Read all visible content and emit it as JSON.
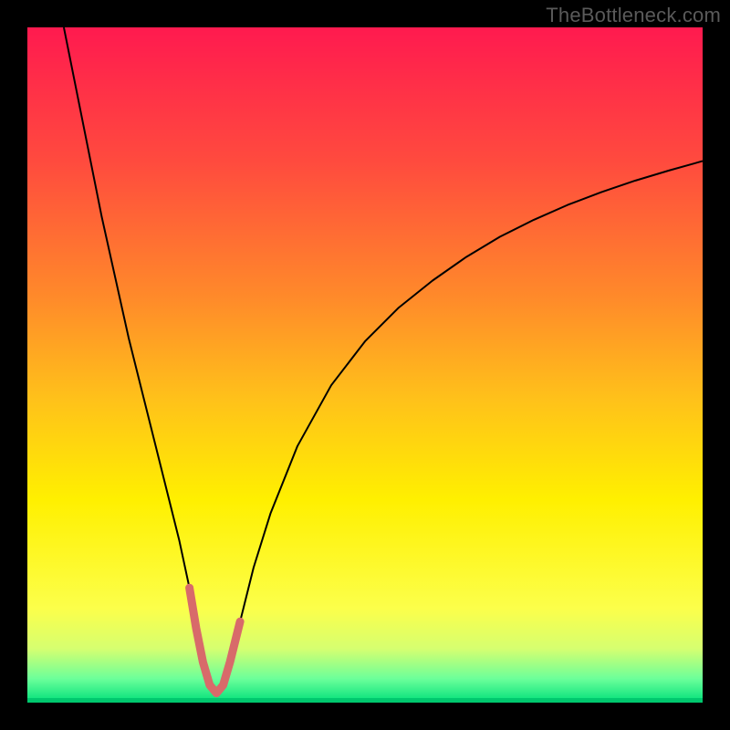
{
  "watermark": "TheBottleneck.com",
  "chart_data": {
    "type": "line",
    "title": "",
    "xlabel": "",
    "ylabel": "",
    "xlim": [
      0,
      100
    ],
    "ylim": [
      0,
      100
    ],
    "gradient": {
      "stops": [
        {
          "offset": 0.0,
          "color": "#ff1a4f"
        },
        {
          "offset": 0.2,
          "color": "#ff4b3e"
        },
        {
          "offset": 0.4,
          "color": "#ff8a2a"
        },
        {
          "offset": 0.55,
          "color": "#ffc11a"
        },
        {
          "offset": 0.7,
          "color": "#fff000"
        },
        {
          "offset": 0.86,
          "color": "#fcff4a"
        },
        {
          "offset": 0.92,
          "color": "#d6ff70"
        },
        {
          "offset": 0.965,
          "color": "#6bff9a"
        },
        {
          "offset": 1.0,
          "color": "#00e07a"
        }
      ]
    },
    "series": [
      {
        "name": "curve",
        "stroke": "#000000",
        "stroke_width": 2,
        "x": [
          5.4,
          7,
          9,
          11,
          13,
          15,
          17,
          19,
          21,
          22.5,
          24,
          25,
          26,
          27,
          28,
          29,
          30,
          31.5,
          33.5,
          36,
          40,
          45,
          50,
          55,
          60,
          65,
          70,
          75,
          80,
          85,
          90,
          95,
          100
        ],
        "y": [
          100,
          92,
          82,
          72,
          63,
          54,
          46,
          38,
          30,
          24,
          17,
          11,
          6,
          2.6,
          1.4,
          2.6,
          6,
          12,
          20,
          28,
          38,
          47,
          53.5,
          58.5,
          62.5,
          66,
          69,
          71.5,
          73.7,
          75.6,
          77.3,
          78.8,
          80.2
        ]
      },
      {
        "name": "highlight",
        "stroke": "#d86a6a",
        "stroke_width": 9,
        "linecap": "round",
        "x": [
          24,
          25,
          26,
          27,
          28,
          29,
          30,
          31.5
        ],
        "y": [
          17,
          11,
          6,
          2.6,
          1.4,
          2.6,
          6,
          12
        ]
      }
    ],
    "baseline": {
      "color": "#00c86e",
      "y": 0,
      "thickness_px_top": 5
    }
  }
}
